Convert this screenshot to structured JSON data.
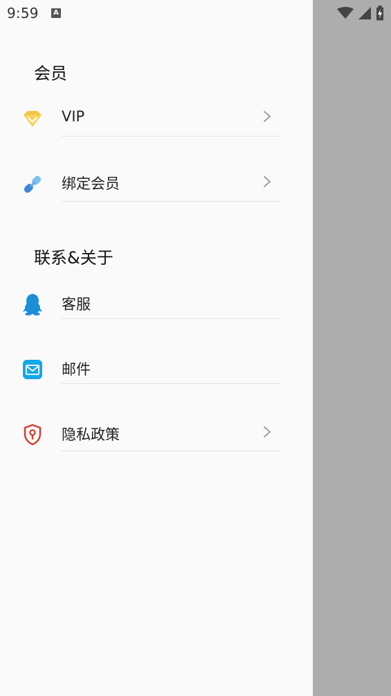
{
  "status_bar": {
    "time": "9:59",
    "notification_icon": "A"
  },
  "sections": [
    {
      "title": "会员",
      "items": [
        {
          "label": "VIP",
          "icon": "diamond-icon",
          "has_chevron": true
        },
        {
          "label": "绑定会员",
          "icon": "link-icon",
          "has_chevron": true
        }
      ]
    },
    {
      "title": "联系&关于",
      "items": [
        {
          "label": "客服",
          "icon": "qq-penguin-icon",
          "has_chevron": false
        },
        {
          "label": "邮件",
          "icon": "mail-icon",
          "has_chevron": false
        },
        {
          "label": "隐私政策",
          "icon": "shield-lock-icon",
          "has_chevron": true
        }
      ]
    }
  ],
  "colors": {
    "drawer_bg": "#fafafa",
    "scrim": "#adadad",
    "divider": "#e3e3e3",
    "vip_gold": "#f2c744",
    "link_blue": "#5aa8e8",
    "qq_blue": "#1a8fd8",
    "mail_blue": "#12a8e8",
    "shield_red": "#d93a2b"
  }
}
